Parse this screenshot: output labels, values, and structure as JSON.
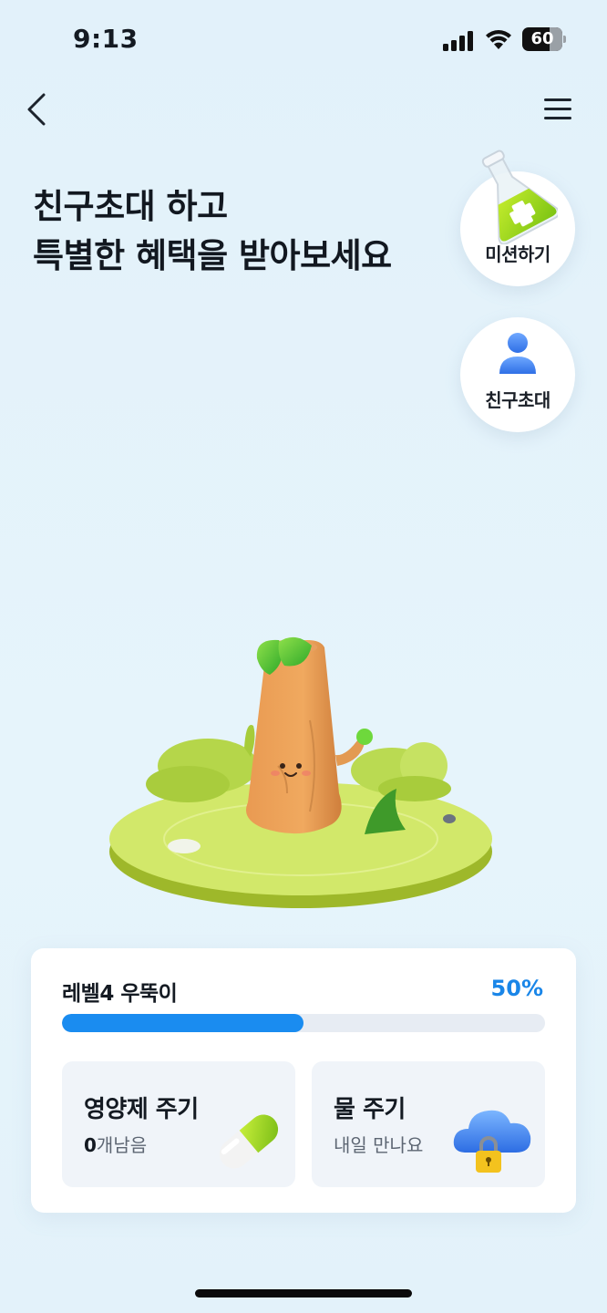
{
  "status_bar": {
    "time": "9:13",
    "battery": "60"
  },
  "nav": {
    "back_icon": "chevron-left-icon",
    "menu_icon": "hamburger-menu-icon"
  },
  "headline": {
    "line1": "친구초대 하고",
    "line2": "특별한 혜택을 받아보세요"
  },
  "side_buttons": {
    "mission": {
      "label": "미션하기",
      "icon": "flask-plus-icon"
    },
    "invite": {
      "label": "친구초대",
      "icon": "person-icon"
    }
  },
  "scene": {
    "character": "tree-stump-character",
    "island": "grass-island"
  },
  "level_card": {
    "title": "레벨4 우뚝이",
    "percent_text": "50%",
    "progress": 0.5,
    "actions": [
      {
        "title": "영양제 주기",
        "count": "0",
        "sub": "개남음",
        "icon": "pill-capsule-icon"
      },
      {
        "title": "물 주기",
        "sub": "내일 만나요",
        "icon": "locked-cloud-icon"
      }
    ]
  },
  "colors": {
    "accent": "#1a8cf0",
    "background": "#e3f2fa",
    "card": "#ffffff",
    "tile": "#f0f4f9"
  }
}
